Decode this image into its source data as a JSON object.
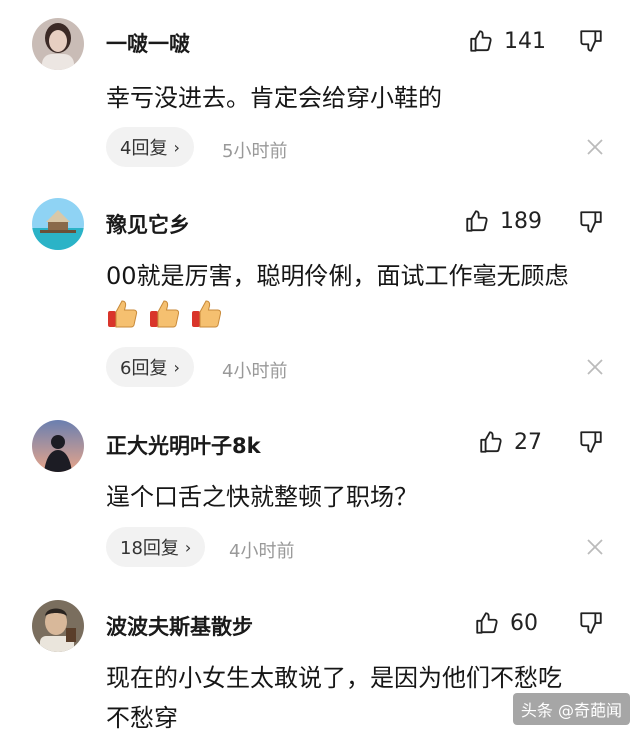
{
  "comments": [
    {
      "username": "一啵一啵",
      "likes": "141",
      "text": "幸亏没进去。肯定会给穿小鞋的",
      "replies": "4回复",
      "time": "5小时前",
      "avatar": "avatar-woman-icon"
    },
    {
      "username": "豫见它乡",
      "likes": "189",
      "text": "00就是厉害，聪明伶俐，面试工作毫无顾虑",
      "emojis": [
        "thumbs-up-emoji",
        "thumbs-up-emoji",
        "thumbs-up-emoji"
      ],
      "replies": "6回复",
      "time": "4小时前",
      "avatar": "avatar-beach-icon"
    },
    {
      "username": "正大光明叶子8k",
      "likes": "27",
      "text": "逞个口舌之快就整顿了职场？",
      "replies": "18回复",
      "time": "4小时前",
      "avatar": "avatar-silhouette-icon"
    },
    {
      "username": "波波夫斯基散步",
      "likes": "60",
      "text": "现在的小女生太敢说了，是因为他们不愁吃不愁穿",
      "avatar": "avatar-man-icon"
    }
  ],
  "reply_chevron": "›",
  "watermark": "头条 @奇葩闻"
}
